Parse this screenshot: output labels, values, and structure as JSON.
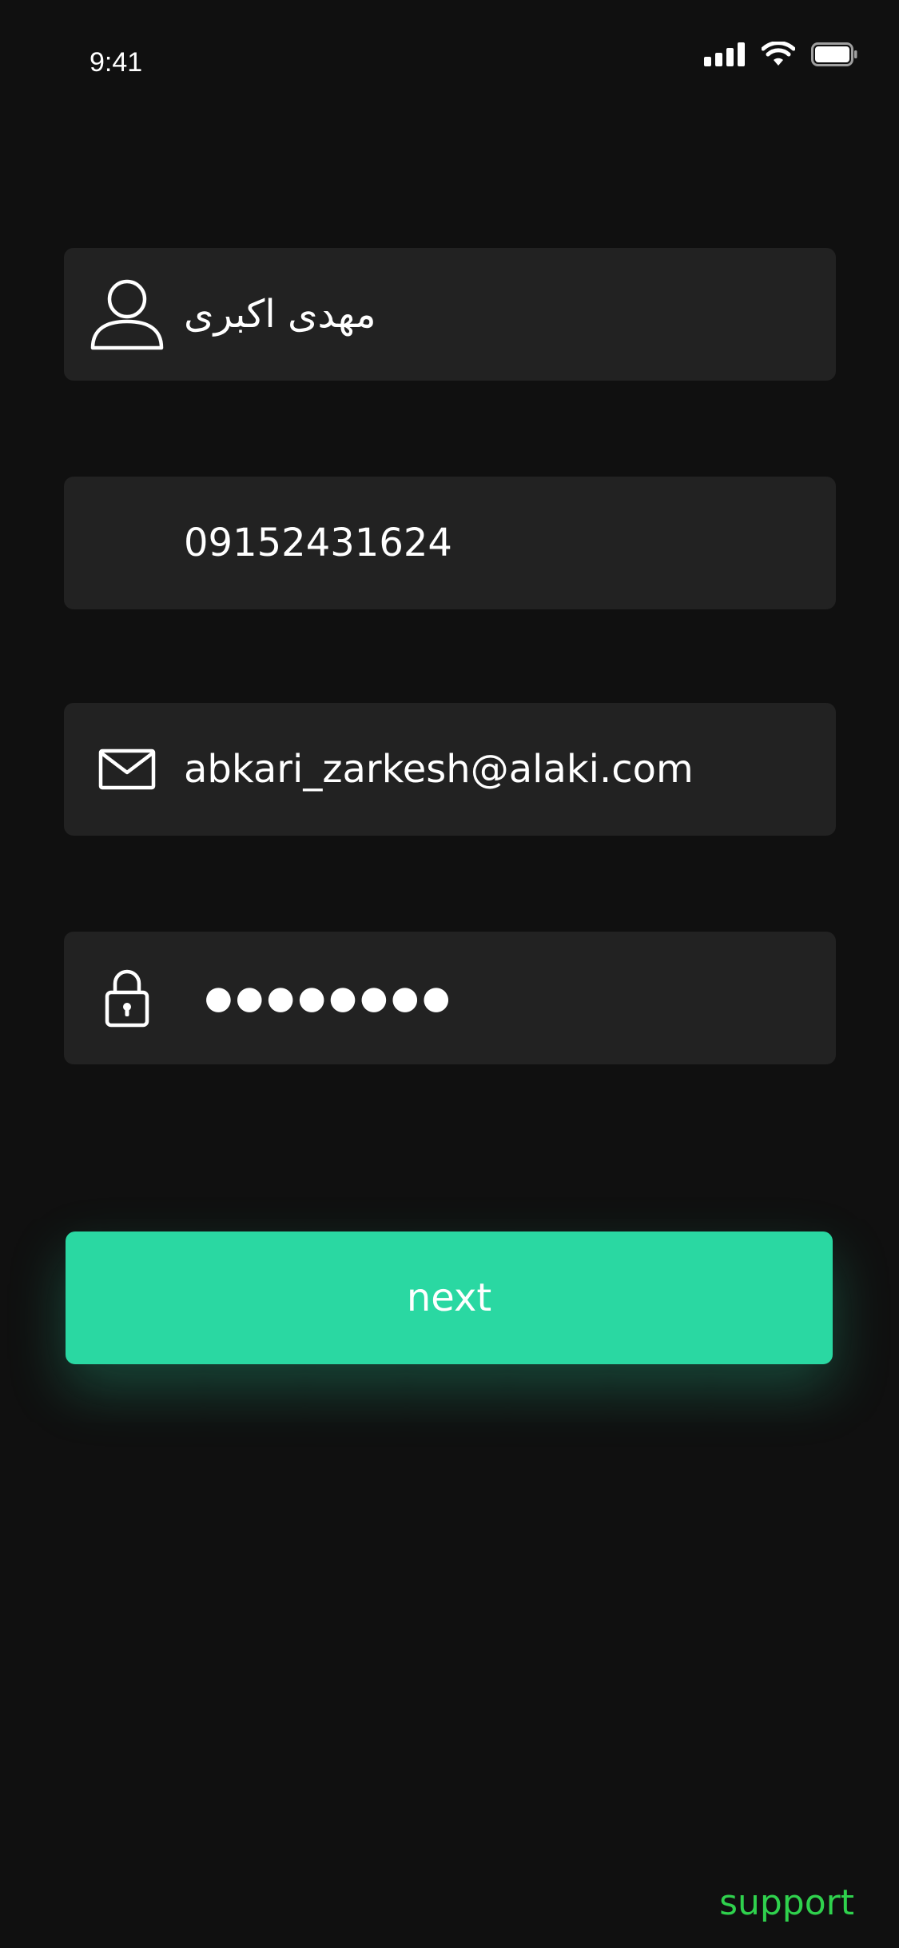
{
  "status_bar": {
    "time": "9:41",
    "icons": [
      "cellular-signal-icon",
      "wifi-icon",
      "battery-icon"
    ]
  },
  "form": {
    "name": {
      "icon": "user-icon",
      "value": "مهدی اکبری"
    },
    "phone": {
      "value": "09152431624"
    },
    "email": {
      "icon": "mail-icon",
      "value": "abkari_zarkesh@alaki.com"
    },
    "password": {
      "icon": "lock-icon",
      "value": "●●●●●●●●"
    }
  },
  "actions": {
    "next_label": "next",
    "support_label": "support"
  },
  "colors": {
    "background": "#101010",
    "field_background": "#222222",
    "accent": "#2ad8a2",
    "support": "#2fd14d"
  }
}
